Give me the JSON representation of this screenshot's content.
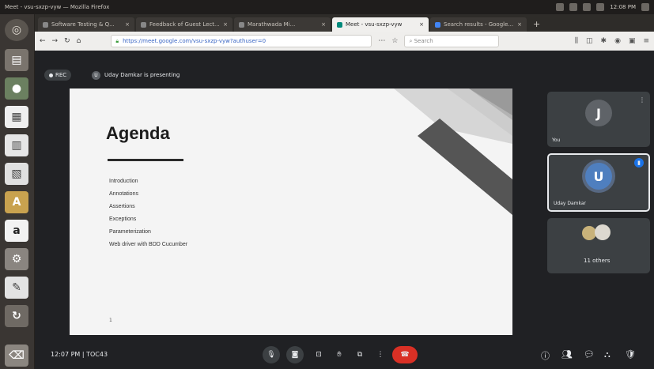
{
  "window": {
    "title": "Meet - vsu-sxzp-vyw — Mozilla Firefox",
    "clock": "12:08 PM"
  },
  "tabs": [
    {
      "label": "Software Testing & Q...",
      "active": false
    },
    {
      "label": "Feedback of Guest Lect...",
      "active": false
    },
    {
      "label": "Marathwada Mi...",
      "active": false
    },
    {
      "label": "Meet - vsu-sxzp-vyw",
      "active": true
    },
    {
      "label": "Search results - Google...",
      "active": false
    }
  ],
  "navbar": {
    "url": "https://meet.google.com/vsu-sxzp-vyw?authuser=0",
    "search_placeholder": "Search"
  },
  "meet": {
    "rec_label": "REC",
    "presenter_initial": "U",
    "presenting_text": "Uday Damkar is presenting",
    "slide": {
      "title": "Agenda",
      "items": [
        "Introduction",
        "Annotations",
        "Assertions",
        "Exceptions",
        "Parameterization",
        "Web driver with BDD Cucumber"
      ],
      "page_marker": "1"
    },
    "participants": [
      {
        "initial": "J",
        "name": "You",
        "color": "#5f6368"
      },
      {
        "initial": "U",
        "name": "Uday Damkar",
        "color": "#4f7fbf"
      }
    ],
    "others_label": "11 others",
    "time": "12:07 PM",
    "meeting_code": "TOC43"
  },
  "colors": {
    "meet_bg": "#202124",
    "tile_bg": "#3c4043",
    "end_call": "#d93025",
    "accent": "#8ab4f8"
  }
}
